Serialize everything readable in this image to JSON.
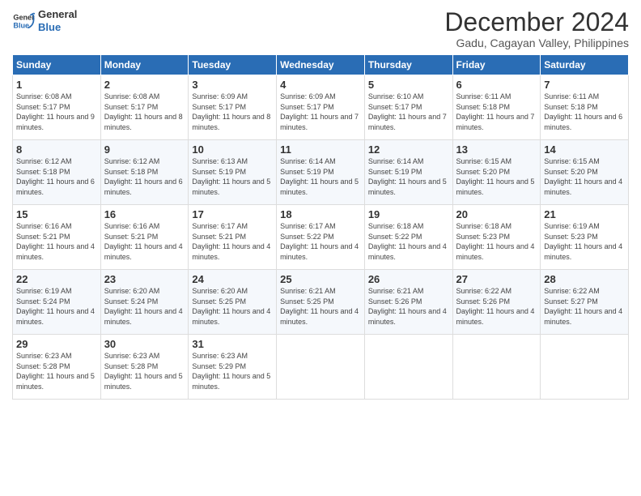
{
  "logo": {
    "line1": "General",
    "line2": "Blue"
  },
  "title": "December 2024",
  "subtitle": "Gadu, Cagayan Valley, Philippines",
  "days_header": [
    "Sunday",
    "Monday",
    "Tuesday",
    "Wednesday",
    "Thursday",
    "Friday",
    "Saturday"
  ],
  "weeks": [
    [
      {
        "num": "1",
        "sunrise": "6:08 AM",
        "sunset": "5:17 PM",
        "daylight": "11 hours and 9 minutes."
      },
      {
        "num": "2",
        "sunrise": "6:08 AM",
        "sunset": "5:17 PM",
        "daylight": "11 hours and 8 minutes."
      },
      {
        "num": "3",
        "sunrise": "6:09 AM",
        "sunset": "5:17 PM",
        "daylight": "11 hours and 8 minutes."
      },
      {
        "num": "4",
        "sunrise": "6:09 AM",
        "sunset": "5:17 PM",
        "daylight": "11 hours and 7 minutes."
      },
      {
        "num": "5",
        "sunrise": "6:10 AM",
        "sunset": "5:17 PM",
        "daylight": "11 hours and 7 minutes."
      },
      {
        "num": "6",
        "sunrise": "6:11 AM",
        "sunset": "5:18 PM",
        "daylight": "11 hours and 7 minutes."
      },
      {
        "num": "7",
        "sunrise": "6:11 AM",
        "sunset": "5:18 PM",
        "daylight": "11 hours and 6 minutes."
      }
    ],
    [
      {
        "num": "8",
        "sunrise": "6:12 AM",
        "sunset": "5:18 PM",
        "daylight": "11 hours and 6 minutes."
      },
      {
        "num": "9",
        "sunrise": "6:12 AM",
        "sunset": "5:18 PM",
        "daylight": "11 hours and 6 minutes."
      },
      {
        "num": "10",
        "sunrise": "6:13 AM",
        "sunset": "5:19 PM",
        "daylight": "11 hours and 5 minutes."
      },
      {
        "num": "11",
        "sunrise": "6:14 AM",
        "sunset": "5:19 PM",
        "daylight": "11 hours and 5 minutes."
      },
      {
        "num": "12",
        "sunrise": "6:14 AM",
        "sunset": "5:19 PM",
        "daylight": "11 hours and 5 minutes."
      },
      {
        "num": "13",
        "sunrise": "6:15 AM",
        "sunset": "5:20 PM",
        "daylight": "11 hours and 5 minutes."
      },
      {
        "num": "14",
        "sunrise": "6:15 AM",
        "sunset": "5:20 PM",
        "daylight": "11 hours and 4 minutes."
      }
    ],
    [
      {
        "num": "15",
        "sunrise": "6:16 AM",
        "sunset": "5:21 PM",
        "daylight": "11 hours and 4 minutes."
      },
      {
        "num": "16",
        "sunrise": "6:16 AM",
        "sunset": "5:21 PM",
        "daylight": "11 hours and 4 minutes."
      },
      {
        "num": "17",
        "sunrise": "6:17 AM",
        "sunset": "5:21 PM",
        "daylight": "11 hours and 4 minutes."
      },
      {
        "num": "18",
        "sunrise": "6:17 AM",
        "sunset": "5:22 PM",
        "daylight": "11 hours and 4 minutes."
      },
      {
        "num": "19",
        "sunrise": "6:18 AM",
        "sunset": "5:22 PM",
        "daylight": "11 hours and 4 minutes."
      },
      {
        "num": "20",
        "sunrise": "6:18 AM",
        "sunset": "5:23 PM",
        "daylight": "11 hours and 4 minutes."
      },
      {
        "num": "21",
        "sunrise": "6:19 AM",
        "sunset": "5:23 PM",
        "daylight": "11 hours and 4 minutes."
      }
    ],
    [
      {
        "num": "22",
        "sunrise": "6:19 AM",
        "sunset": "5:24 PM",
        "daylight": "11 hours and 4 minutes."
      },
      {
        "num": "23",
        "sunrise": "6:20 AM",
        "sunset": "5:24 PM",
        "daylight": "11 hours and 4 minutes."
      },
      {
        "num": "24",
        "sunrise": "6:20 AM",
        "sunset": "5:25 PM",
        "daylight": "11 hours and 4 minutes."
      },
      {
        "num": "25",
        "sunrise": "6:21 AM",
        "sunset": "5:25 PM",
        "daylight": "11 hours and 4 minutes."
      },
      {
        "num": "26",
        "sunrise": "6:21 AM",
        "sunset": "5:26 PM",
        "daylight": "11 hours and 4 minutes."
      },
      {
        "num": "27",
        "sunrise": "6:22 AM",
        "sunset": "5:26 PM",
        "daylight": "11 hours and 4 minutes."
      },
      {
        "num": "28",
        "sunrise": "6:22 AM",
        "sunset": "5:27 PM",
        "daylight": "11 hours and 4 minutes."
      }
    ],
    [
      {
        "num": "29",
        "sunrise": "6:23 AM",
        "sunset": "5:28 PM",
        "daylight": "11 hours and 5 minutes."
      },
      {
        "num": "30",
        "sunrise": "6:23 AM",
        "sunset": "5:28 PM",
        "daylight": "11 hours and 5 minutes."
      },
      {
        "num": "31",
        "sunrise": "6:23 AM",
        "sunset": "5:29 PM",
        "daylight": "11 hours and 5 minutes."
      },
      null,
      null,
      null,
      null
    ]
  ],
  "labels": {
    "sunrise_prefix": "Sunrise: ",
    "sunset_prefix": "Sunset: ",
    "daylight_prefix": "Daylight: "
  }
}
